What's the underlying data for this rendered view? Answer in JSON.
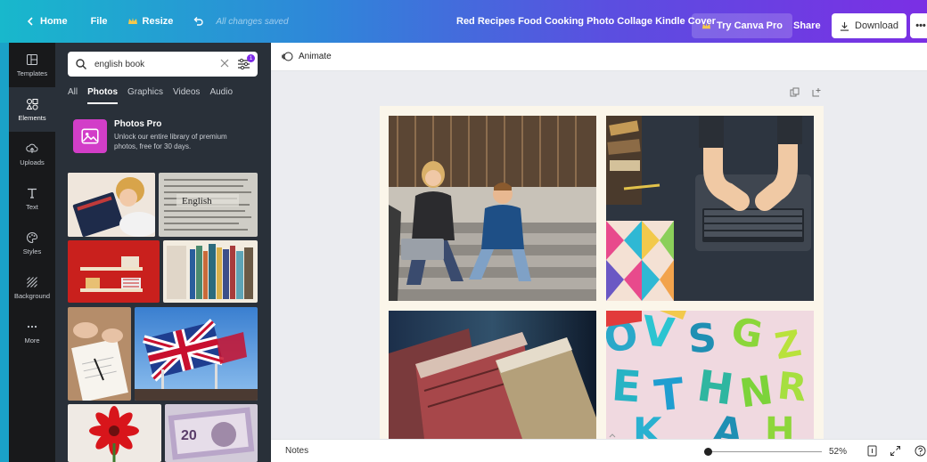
{
  "topbar": {
    "home": "Home",
    "file": "File",
    "resize": "Resize",
    "saved": "All changes saved",
    "title": "Red Recipes Food Cooking Photo Collage Kindle Cover",
    "try_pro": "Try Canva Pro",
    "share": "Share",
    "download": "Download",
    "more": "•••"
  },
  "nav": {
    "templates": "Templates",
    "elements": "Elements",
    "uploads": "Uploads",
    "text": "Text",
    "styles": "Styles",
    "background": "Background",
    "more": "More"
  },
  "panel": {
    "search_value": "english book",
    "filter_badge": "1",
    "tabs": [
      "All",
      "Photos",
      "Graphics",
      "Videos",
      "Audio"
    ],
    "active_tab": "Photos",
    "promo_title": "Photos Pro",
    "promo_desc": "Unlock our entire library of premium photos, free for 30 days."
  },
  "editor": {
    "animate": "Animate",
    "notes": "Notes",
    "zoom": "52%",
    "zoom_fraction": 0.0
  },
  "colors": {
    "gradient_start": "#18b8cc",
    "gradient_end": "#7b2fe4",
    "panel_bg": "#293039",
    "nav_bg": "#18191b",
    "promo_icon": "#d23ec8"
  }
}
